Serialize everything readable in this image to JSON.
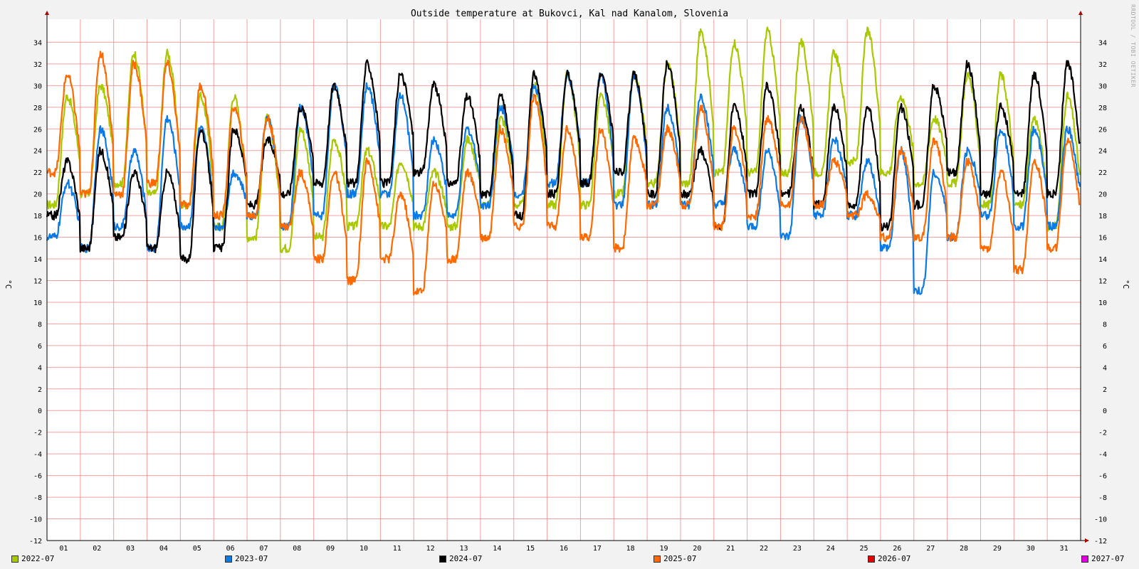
{
  "chart_data": {
    "type": "line",
    "title": "Outside temperature at Bukovci, Kal nad Kanalom, Slovenia",
    "ylabel": "°C",
    "ylabel_right": "°C",
    "ylim": [
      -12,
      35
    ],
    "yticks": [
      34,
      32,
      30,
      28,
      26,
      24,
      22,
      20,
      18,
      16,
      14,
      12,
      10,
      8,
      6,
      4,
      2,
      0,
      -2,
      -4,
      -6,
      -8,
      -10,
      -12
    ],
    "xticks": [
      "01",
      "02",
      "03",
      "04",
      "05",
      "06",
      "07",
      "08",
      "09",
      "10",
      "11",
      "12",
      "13",
      "14",
      "15",
      "16",
      "17",
      "18",
      "19",
      "20",
      "21",
      "22",
      "23",
      "24",
      "25",
      "26",
      "27",
      "28",
      "29",
      "30",
      "31"
    ],
    "grid": true,
    "background": "#ffffff",
    "grid_color": "#f08080",
    "series": [
      {
        "name": "2022-07",
        "color": "#a8c800",
        "daily": [
          [
            19,
            29
          ],
          [
            20,
            30
          ],
          [
            21,
            33
          ],
          [
            20,
            33
          ],
          [
            19,
            29
          ],
          [
            17,
            29
          ],
          [
            16,
            27
          ],
          [
            15,
            26
          ],
          [
            16,
            25
          ],
          [
            17,
            24
          ],
          [
            17,
            23
          ],
          [
            17,
            22
          ],
          [
            17,
            25
          ],
          [
            19,
            27
          ],
          [
            19,
            30
          ],
          [
            19,
            31
          ],
          [
            19,
            29
          ],
          [
            20,
            31
          ],
          [
            21,
            32
          ],
          [
            21,
            35
          ],
          [
            22,
            34
          ],
          [
            22,
            35
          ],
          [
            22,
            34
          ],
          [
            22,
            33
          ],
          [
            23,
            35
          ],
          [
            22,
            29
          ],
          [
            21,
            27
          ],
          [
            21,
            31
          ],
          [
            19,
            31
          ],
          [
            19,
            27
          ],
          [
            17,
            29
          ]
        ]
      },
      {
        "name": "2023-07",
        "color": "#0a7ae6",
        "daily": [
          [
            16,
            21
          ],
          [
            15,
            26
          ],
          [
            17,
            24
          ],
          [
            15,
            27
          ],
          [
            17,
            26
          ],
          [
            17,
            22
          ],
          [
            18,
            27
          ],
          [
            17,
            28
          ],
          [
            18,
            30
          ],
          [
            20,
            30
          ],
          [
            20,
            29
          ],
          [
            18,
            25
          ],
          [
            18,
            26
          ],
          [
            19,
            28
          ],
          [
            20,
            30
          ],
          [
            21,
            31
          ],
          [
            21,
            31
          ],
          [
            19,
            31
          ],
          [
            19,
            28
          ],
          [
            19,
            29
          ],
          [
            19,
            24
          ],
          [
            17,
            24
          ],
          [
            16,
            27
          ],
          [
            18,
            25
          ],
          [
            18,
            23
          ],
          [
            15,
            24
          ],
          [
            11,
            22
          ],
          [
            16,
            24
          ],
          [
            18,
            26
          ],
          [
            17,
            26
          ],
          [
            17,
            26
          ]
        ]
      },
      {
        "name": "2024-07",
        "color": "#000000",
        "daily": [
          [
            18,
            23
          ],
          [
            15,
            24
          ],
          [
            16,
            22
          ],
          [
            15,
            22
          ],
          [
            14,
            26
          ],
          [
            15,
            26
          ],
          [
            19,
            25
          ],
          [
            20,
            28
          ],
          [
            21,
            30
          ],
          [
            21,
            32
          ],
          [
            21,
            31
          ],
          [
            22,
            30
          ],
          [
            21,
            29
          ],
          [
            20,
            29
          ],
          [
            18,
            31
          ],
          [
            20,
            31
          ],
          [
            21,
            31
          ],
          [
            22,
            31
          ],
          [
            20,
            32
          ],
          [
            20,
            24
          ],
          [
            17,
            28
          ],
          [
            20,
            30
          ],
          [
            20,
            28
          ],
          [
            19,
            28
          ],
          [
            19,
            28
          ],
          [
            17,
            28
          ],
          [
            19,
            30
          ],
          [
            22,
            32
          ],
          [
            20,
            28
          ],
          [
            20,
            31
          ],
          [
            20,
            32
          ]
        ]
      },
      {
        "name": "2025-07",
        "color": "#ff6a00",
        "daily": [
          [
            22,
            31
          ],
          [
            20,
            33
          ],
          [
            20,
            32
          ],
          [
            21,
            32
          ],
          [
            19,
            30
          ],
          [
            18,
            28
          ],
          [
            18,
            27
          ],
          [
            17,
            22
          ],
          [
            14,
            22
          ],
          [
            12,
            23
          ],
          [
            14,
            20
          ],
          [
            11,
            21
          ],
          [
            14,
            22
          ],
          [
            16,
            26
          ],
          [
            17,
            29
          ],
          [
            17,
            26
          ],
          [
            16,
            26
          ],
          [
            15,
            25
          ],
          [
            19,
            26
          ],
          [
            19,
            28
          ],
          [
            17,
            26
          ],
          [
            18,
            27
          ],
          [
            19,
            27
          ],
          [
            19,
            23
          ],
          [
            18,
            20
          ],
          [
            16,
            24
          ],
          [
            16,
            25
          ],
          [
            16,
            23
          ],
          [
            15,
            22
          ],
          [
            13,
            23
          ],
          [
            15,
            25
          ]
        ]
      },
      {
        "name": "2026-07",
        "color": "#e00000",
        "daily": []
      },
      {
        "name": "2027-07",
        "color": "#e000e0",
        "daily": []
      }
    ]
  },
  "watermark": "RRDTOOL / TOBI OETIKER"
}
